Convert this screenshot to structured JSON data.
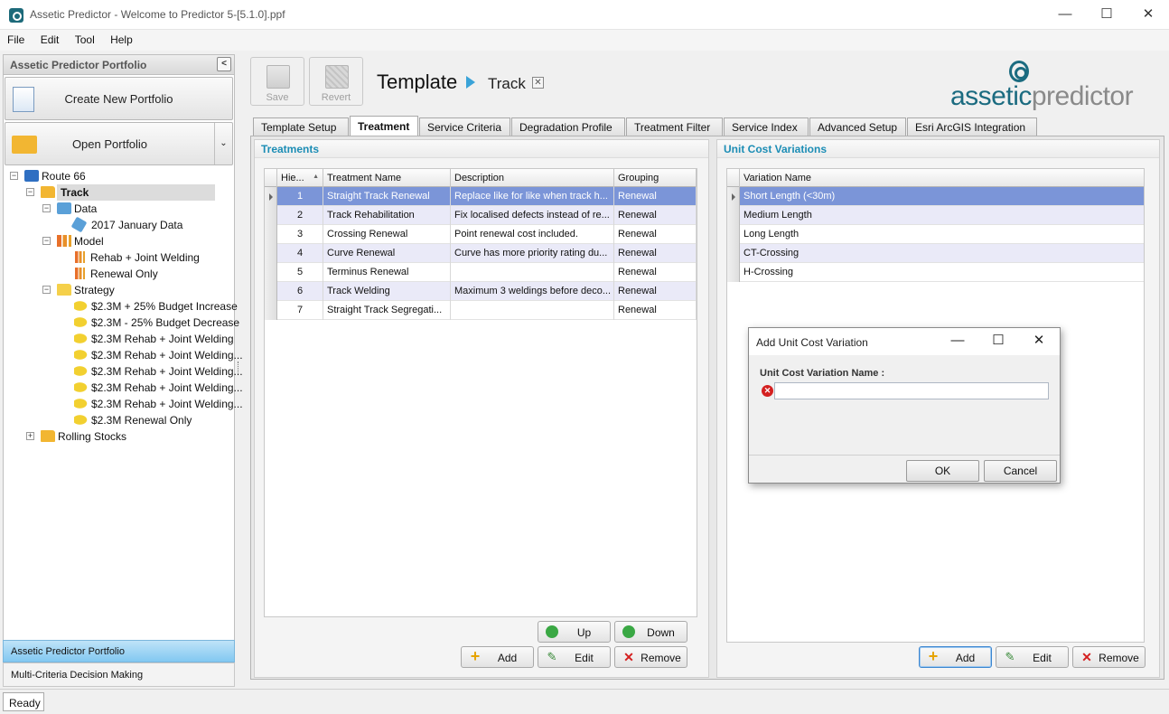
{
  "window": {
    "title": "Assetic Predictor - Welcome to Predictor 5-[5.1.0].ppf",
    "minimize": "—",
    "maximize": "☐",
    "close": "✕"
  },
  "menu": [
    "File",
    "Edit",
    "Tool",
    "Help"
  ],
  "sidebar": {
    "header": "Assetic Predictor Portfolio",
    "collapse_glyph": "<",
    "create_button": "Create New Portfolio",
    "open_button": "Open Portfolio",
    "open_drop_glyph": "⌄",
    "tree": {
      "root": "Route 66",
      "track": "Track",
      "data": "Data",
      "data_item": "2017 January Data",
      "model": "Model",
      "model_items": [
        "Rehab + Joint Welding",
        "Renewal Only"
      ],
      "strategy": "Strategy",
      "strategy_items": [
        "$2.3M + 25% Budget Increase",
        "$2.3M - 25% Budget Decrease",
        "$2.3M Rehab + Joint Welding",
        "$2.3M Rehab + Joint Welding...",
        "$2.3M Rehab + Joint Welding...",
        "$2.3M Rehab + Joint Welding...",
        "$2.3M Rehab + Joint Welding...",
        "$2.3M Renewal Only"
      ],
      "rolling": "Rolling Stocks"
    },
    "nav_active": "Assetic Predictor Portfolio",
    "nav_other": "Multi-Criteria Decision Making"
  },
  "toolbar": {
    "save": "Save",
    "revert": "Revert"
  },
  "breadcrumb": {
    "template": "Template",
    "track": "Track",
    "close_glyph": "✕"
  },
  "brand": {
    "part1": "assetic",
    "part2": "predictor"
  },
  "tabs": [
    "Template Setup",
    "Treatment",
    "Service Criteria",
    "Degradation Profile",
    "Treatment Filter",
    "Service Index",
    "Advanced Setup",
    "Esri ArcGIS Integration"
  ],
  "treatments": {
    "title": "Treatments",
    "columns": [
      "Hie...",
      "Treatment Name",
      "Description",
      "Grouping"
    ],
    "sort_glyph": "▲",
    "rows": [
      [
        "1",
        "Straight Track Renewal",
        "Replace like for like when track h...",
        "Renewal"
      ],
      [
        "2",
        "Track Rehabilitation",
        "Fix localised defects instead of re...",
        "Renewal"
      ],
      [
        "3",
        "Crossing Renewal",
        "Point renewal cost included.",
        "Renewal"
      ],
      [
        "4",
        "Curve Renewal",
        "Curve has more priority rating du...",
        "Renewal"
      ],
      [
        "5",
        "Terminus Renewal",
        "",
        "Renewal"
      ],
      [
        "6",
        "Track Welding",
        "Maximum 3 weldings before deco...",
        "Renewal"
      ],
      [
        "7",
        "Straight Track Segregati...",
        "",
        "Renewal"
      ]
    ],
    "buttons": {
      "up": "Up",
      "down": "Down",
      "add": "Add",
      "edit": "Edit",
      "remove": "Remove"
    }
  },
  "ucv": {
    "title": "Unit Cost Variations",
    "column": "Variation Name",
    "rows": [
      "Short Length (<30m)",
      "Medium Length",
      "Long Length",
      "CT-Crossing",
      "H-Crossing"
    ],
    "buttons": {
      "add": "Add",
      "edit": "Edit",
      "remove": "Remove"
    }
  },
  "dialog": {
    "title": "Add Unit Cost Variation",
    "label": "Unit Cost Variation Name :",
    "input_value": "",
    "ok": "OK",
    "cancel": "Cancel",
    "minimize": "—",
    "maximize": "☐",
    "close": "✕"
  },
  "status": "Ready"
}
